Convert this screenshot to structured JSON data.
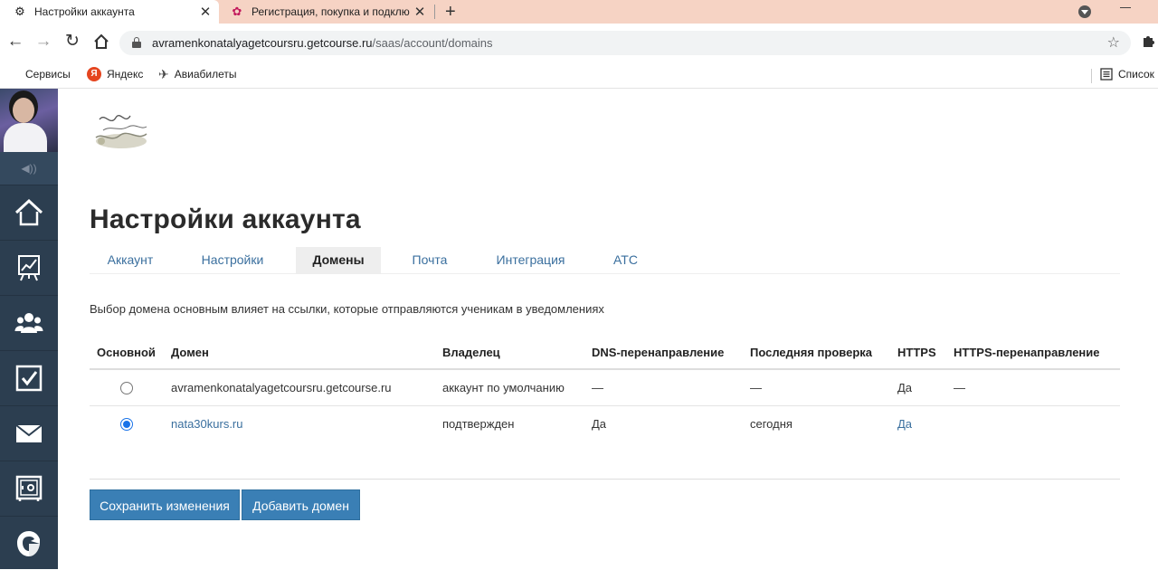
{
  "browser": {
    "tabs": [
      {
        "title": "Настройки аккаунта",
        "active": true,
        "favicon": "gear-icon"
      },
      {
        "title": "Регистрация, покупка и подклю",
        "active": false,
        "favicon": "getcourse-icon"
      }
    ],
    "new_tab_glyph": "+",
    "address": {
      "host": "avramenkonatalyagetcoursru.getcourse.ru",
      "path": "/saas/account/domains"
    },
    "bookmarks": [
      {
        "label": "Сервисы",
        "icon": "apps-grid-icon"
      },
      {
        "label": "Яндекс",
        "icon": "yandex-icon"
      },
      {
        "label": "Авиабилеты",
        "icon": "airplane-icon"
      }
    ],
    "reading_list": "Список"
  },
  "sidebar": {
    "items": [
      {
        "name": "home-icon"
      },
      {
        "name": "chart-icon"
      },
      {
        "name": "users-icon"
      },
      {
        "name": "tasks-icon"
      },
      {
        "name": "mail-icon"
      },
      {
        "name": "safe-icon"
      },
      {
        "name": "getcourse-logo-icon"
      }
    ]
  },
  "page": {
    "title": "Настройки аккаунта",
    "tabs": [
      {
        "label": "Аккаунт",
        "active": false
      },
      {
        "label": "Настройки",
        "active": false
      },
      {
        "label": "Домены",
        "active": true
      },
      {
        "label": "Почта",
        "active": false
      },
      {
        "label": "Интеграция",
        "active": false
      },
      {
        "label": "АТС",
        "active": false
      }
    ],
    "hint": "Выбор домена основным влияет на ссылки, которые отправляются ученикам в уведомлениях"
  },
  "table": {
    "headers": [
      "Основной",
      "Домен",
      "Владелец",
      "DNS-перенаправление",
      "Последняя проверка",
      "HTTPS",
      "HTTPS-перенаправление"
    ],
    "rows": [
      {
        "primary": false,
        "domain": "avramenkonatalyagetcoursru.getcourse.ru",
        "owner": "аккаунт по умолчанию",
        "dns": "—",
        "last_check": "—",
        "https": "Да",
        "https_redirect": "—"
      },
      {
        "primary": true,
        "domain": "nata30kurs.ru",
        "owner": "подтвержден",
        "dns": "Да",
        "last_check": "сегодня",
        "https": "Да",
        "https_redirect": ""
      }
    ]
  },
  "actions": {
    "save": "Сохранить изменения",
    "add_domain": "Добавить домен"
  },
  "colors": {
    "sidebar_bg": "#2c3e50",
    "link": "#3a6f9e",
    "button": "#3a7fb5",
    "tabstrip": "#f6d3c4"
  }
}
